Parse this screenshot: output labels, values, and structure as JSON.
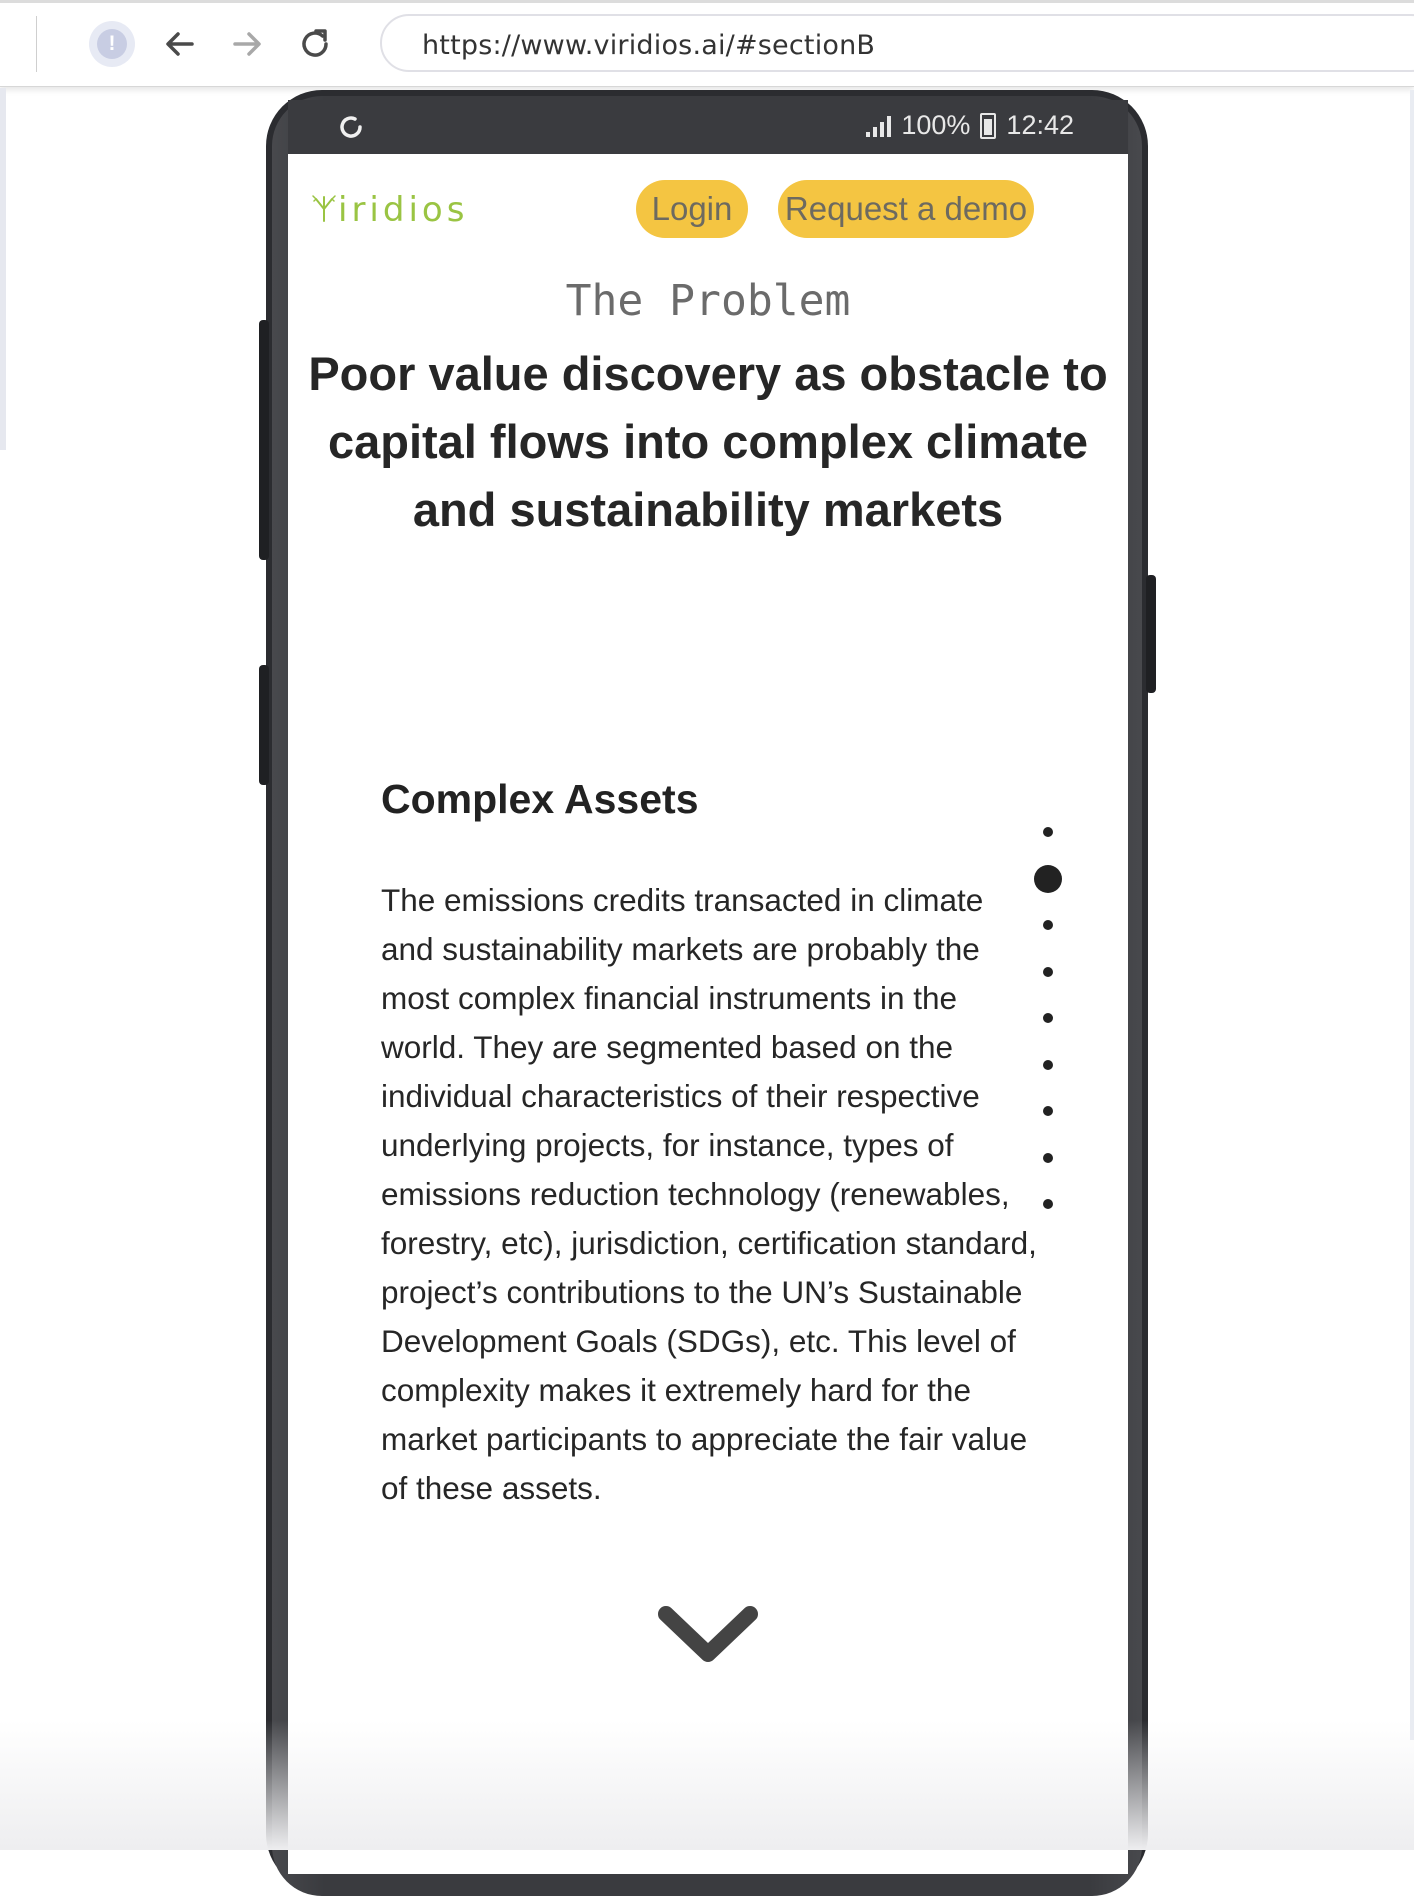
{
  "browser": {
    "url": "https://www.viridios.ai/#sectionB",
    "alert_icon": "!"
  },
  "phone_status": {
    "battery": "100%",
    "time": "12:42"
  },
  "site": {
    "logo_text": "iridios",
    "login_label": "Login",
    "demo_label": "Request a demo",
    "accent_color": "#f4c542",
    "logo_color": "#9ac443"
  },
  "section": {
    "label": "The Problem",
    "headline": "Poor value discovery as obstacle to capital flows into complex climate and sustainability markets"
  },
  "card": {
    "title": "Complex Assets",
    "body": "The emissions credits transacted in climate and sustainability markets are probably the most complex financial instruments in the world. They are segmented based on the individual characteristics of their respective underlying projects, for instance, types of emissions reduction technology (renewables, forestry, etc), jurisdiction, certification standard, project’s contributions to the UN’s Sustainable Development Goals (SDGs), etc. This level of complexity makes it extremely hard for the market participants to appreciate the fair value of these assets.",
    "pagination": {
      "total": 9,
      "active_index": 1
    }
  },
  "icons": [
    "alert-icon",
    "back-arrow-icon",
    "forward-arrow-icon",
    "reload-icon",
    "refresh-icon",
    "signal-icon",
    "battery-icon",
    "viridios-leaf-icon",
    "chevron-down-icon"
  ]
}
